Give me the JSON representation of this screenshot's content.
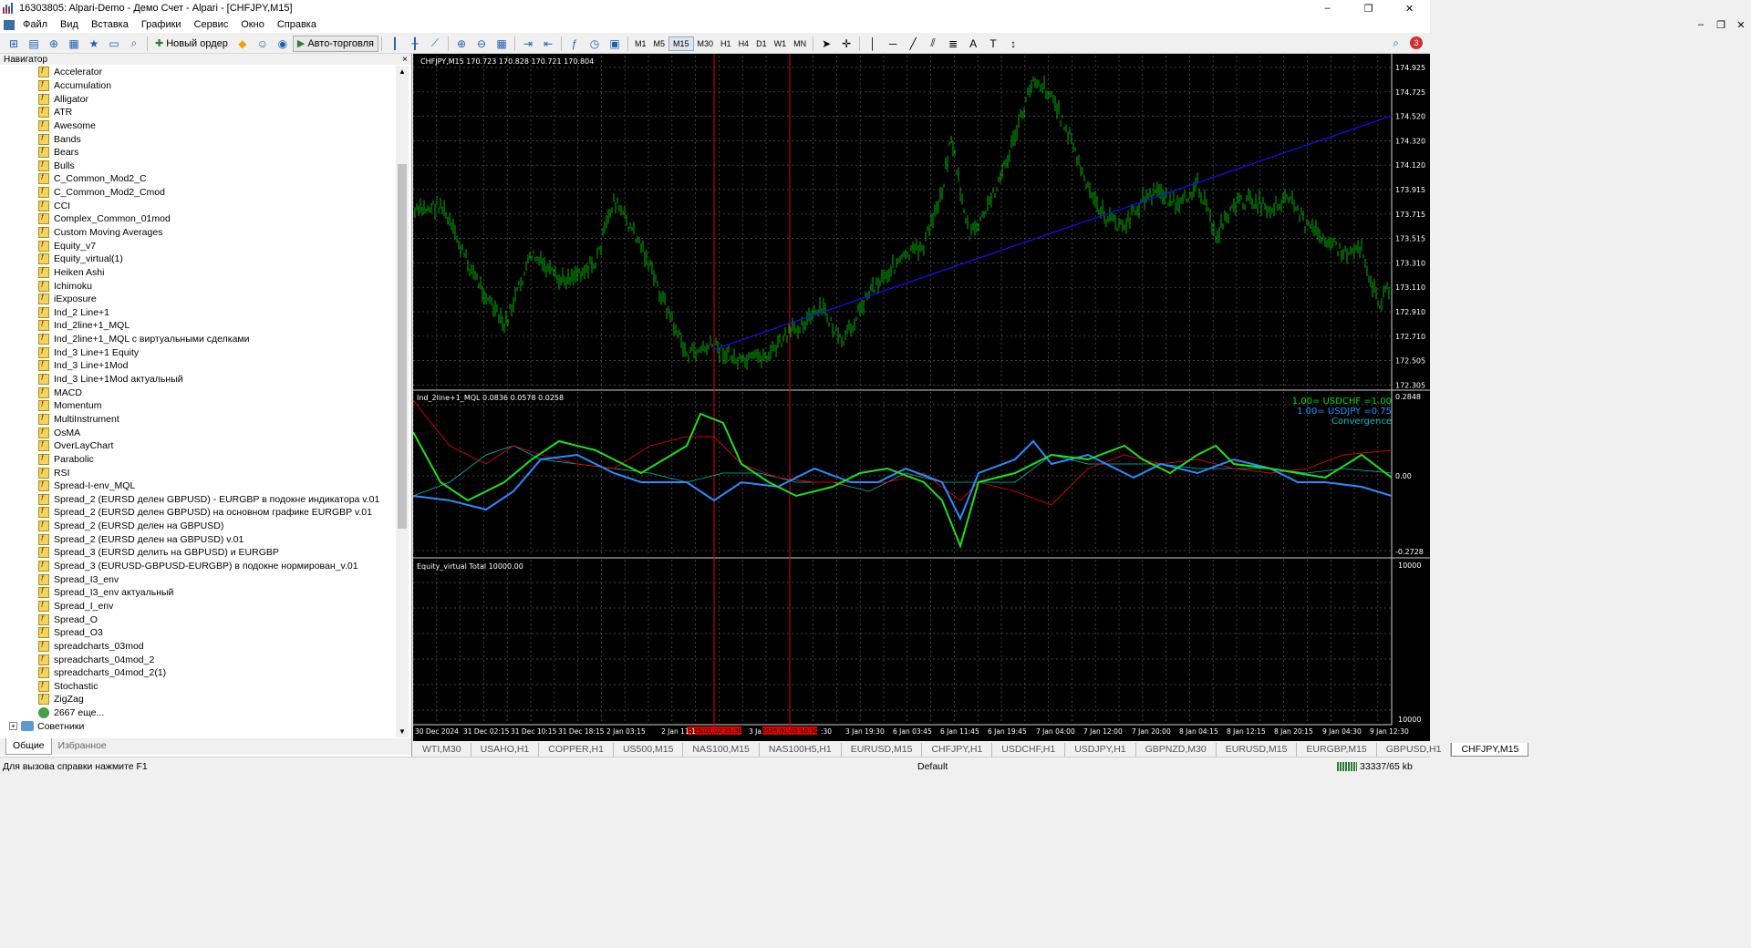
{
  "window": {
    "title": "16303805: Alpari-Demo - Демо Счет - Alpari - [CHFJPY,M15]",
    "controls": [
      "–",
      "❐",
      "✕"
    ]
  },
  "menu": [
    "Файл",
    "Вид",
    "Вставка",
    "Графики",
    "Сервис",
    "Окно",
    "Справка"
  ],
  "mdi_controls": [
    "–",
    "❐",
    "✕"
  ],
  "toolbar": {
    "new_order": "Новый ордер",
    "auto_trading": "Авто-торговля",
    "timeframes": [
      "M1",
      "M5",
      "M15",
      "M30",
      "H1",
      "H4",
      "D1",
      "W1",
      "MN"
    ],
    "active_timeframe": "M15",
    "notification_count": "3"
  },
  "navigator": {
    "title": "Навигатор",
    "close": "×",
    "items": [
      "Accelerator",
      "Accumulation",
      "Alligator",
      "ATR",
      "Awesome",
      "Bands",
      "Bears",
      "Bulls",
      "C_Common_Mod2_C",
      "C_Common_Mod2_Cmod",
      "CCI",
      "Complex_Common_01mod",
      "Custom Moving Averages",
      "Equity_v7",
      "Equity_virtual(1)",
      "Heiken Ashi",
      "Ichimoku",
      "iExposure",
      "Ind_2 Line+1",
      "Ind_2line+1_MQL",
      "Ind_2line+1_MQL с виртуальными сделками",
      "Ind_3 Line+1 Equity",
      "Ind_3 Line+1Mod",
      "Ind_3 Line+1Mod актуальный",
      "MACD",
      "Momentum",
      "MultiInstrument",
      "OsMA",
      "OverLayChart",
      "Parabolic",
      "RSI",
      "Spread-I-env_MQL",
      "Spread_2 (EURSD делен GBPUSD) - EURGBP в подокне индикатора v.01",
      "Spread_2 (EURSD делен GBPUSD) на основном графике  EURGBP v.01",
      "Spread_2 (EURSD делен на GBPUSD)",
      "Spread_2 (EURSD делен на GBPUSD) v.01",
      "Spread_3 (EURSD делить на GBPUSD) и EURGBP",
      "Spread_3 (EURUSD-GBPUSD-EURGBP) в подокне нормирован_v.01",
      "Spread_I3_env",
      "Spread_I3_env актуальный",
      "Spread_I_env",
      "Spread_O",
      "Spread_O3",
      "spreadcharts_03mod",
      "spreadcharts_04mod_2",
      "spreadcharts_04mod_2(1)",
      "Stochastic",
      "ZigZag"
    ],
    "more": "2667 еще...",
    "group_advisors": "Советники",
    "tabs": [
      "Общие",
      "Избранное"
    ]
  },
  "chart": {
    "main_label": "CHFJPY,M15  170.723 170.828 170.721 170.804",
    "price_ticks": [
      "174.925",
      "174.725",
      "174.520",
      "174.320",
      "174.120",
      "173.915",
      "173.715",
      "173.515",
      "173.310",
      "173.110",
      "172.910",
      "172.710",
      "172.505",
      "172.305"
    ],
    "current_price": "",
    "ind_label": "Ind_2line+1_MQL 0.0836 0.0578 0.0258",
    "ind_ticks": [
      "0.2848",
      "0.00",
      "-0.2728"
    ],
    "legend": [
      {
        "text": "1.00= USDCHF =1.00",
        "color": "#00e000"
      },
      {
        "text": "1.00= USDJPY =0.75",
        "color": "#1e90ff"
      },
      {
        "text": "Convergence",
        "color": "#00bfbf"
      }
    ],
    "equity_label": "Equity_virtual Total 10000.00",
    "equity_ticks": [
      "10000",
      "10000"
    ],
    "time_labels": [
      "30 Dec 2024",
      "31 Dec 02:15",
      "31 Dec 10:15",
      "31 Dec 18:15",
      "2 Jan 03:15",
      "2 Jan 11:1",
      "3 Ja",
      ":30",
      "3 Jan 19:30",
      "6 Jan 03:45",
      "6 Jan 11:45",
      "6 Jan 19:45",
      "7 Jan 04:00",
      "7 Jan 12:00",
      "7 Jan 20:00",
      "8 Jan 04:15",
      "8 Jan 12:15",
      "8 Jan 20:15",
      "9 Jan 04:30",
      "9 Jan 12:30"
    ],
    "marker_labels": [
      "2025.01.02 21:30",
      "2025.01.03 10:30"
    ],
    "colors": {
      "bars": "#00b000",
      "trend": "#1010ff",
      "usdchf": "#1ee01e",
      "usdjpy": "#2a8cff",
      "red": "#e00000",
      "grid": "#5a5a5a"
    }
  },
  "symbol_tabs": [
    "WTI,M30",
    "USAHO,H1",
    "COPPER,H1",
    "US500,M15",
    "NAS100,M15",
    "NAS100H5,H1",
    "EURUSD,M15",
    "CHFJPY,H1",
    "USDCHF,H1",
    "USDJPY,H1",
    "GBPNZD,M30",
    "EURUSD,M15",
    "EURGBP,M15",
    "GBPUSD,H1",
    "CHFJPY,M15"
  ],
  "active_symbol_tab": "CHFJPY,M15",
  "status": {
    "help": "Для вызова справки нажмите F1",
    "profile": "Default",
    "traffic": "33337/65 kb"
  }
}
